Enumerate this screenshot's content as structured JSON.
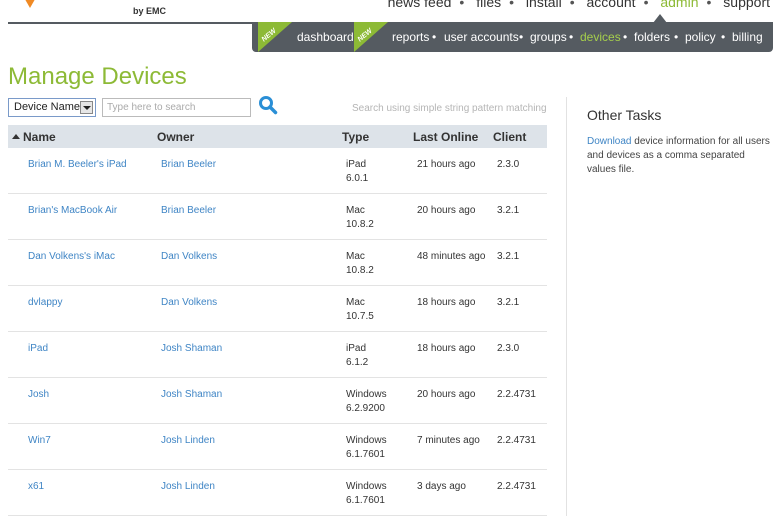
{
  "brand": {
    "byline": "by EMC",
    "accent_color": "#8dba36",
    "logo_icon": "syncplicity-logo-icon"
  },
  "top_nav": {
    "items": [
      "news feed",
      "files",
      "install",
      "account",
      "admin",
      "support"
    ],
    "active": "admin"
  },
  "sub_nav": {
    "badge": "NEW",
    "items": [
      "dashboard",
      "reports",
      "user accounts",
      "groups",
      "devices",
      "folders",
      "policy",
      "billing"
    ],
    "active": "devices"
  },
  "page": {
    "title": "Manage Devices"
  },
  "filter": {
    "field_value": "Device Name",
    "search_placeholder": "Type here to search",
    "hint": "Search using simple string pattern matching"
  },
  "table": {
    "columns": {
      "name": "Name",
      "owner": "Owner",
      "type": "Type",
      "last_online": "Last Online",
      "client": "Client"
    },
    "rows": [
      {
        "name": "Brian M. Beeler's iPad",
        "owner": "Brian Beeler",
        "type": "iPad",
        "version": "6.0.1",
        "last_online": "21 hours ago",
        "client": "2.3.0"
      },
      {
        "name": "Brian's MacBook Air",
        "owner": "Brian Beeler",
        "type": "Mac",
        "version": "10.8.2",
        "last_online": "20 hours ago",
        "client": "3.2.1"
      },
      {
        "name": "Dan Volkens's iMac",
        "owner": "Dan Volkens",
        "type": "Mac",
        "version": "10.8.2",
        "last_online": "48 minutes ago",
        "client": "3.2.1"
      },
      {
        "name": "dvlappy",
        "owner": "Dan Volkens",
        "type": "Mac",
        "version": "10.7.5",
        "last_online": "18 hours ago",
        "client": "3.2.1"
      },
      {
        "name": "iPad",
        "owner": "Josh Shaman",
        "type": "iPad",
        "version": "6.1.2",
        "last_online": "18 hours ago",
        "client": "2.3.0"
      },
      {
        "name": "Josh",
        "owner": "Josh Shaman",
        "type": "Windows",
        "version": "6.2.9200",
        "last_online": "20 hours ago",
        "client": "2.2.4731"
      },
      {
        "name": "Win7",
        "owner": "Josh Linden",
        "type": "Windows",
        "version": "6.1.7601",
        "last_online": "7 minutes ago",
        "client": "2.2.4731"
      },
      {
        "name": "x61",
        "owner": "Josh Linden",
        "type": "Windows",
        "version": "6.1.7601",
        "last_online": "3 days ago",
        "client": "2.2.4731"
      }
    ]
  },
  "sidebar": {
    "title": "Other Tasks",
    "link": "Download",
    "text": " device information for all users and devices as a comma separated values file."
  }
}
